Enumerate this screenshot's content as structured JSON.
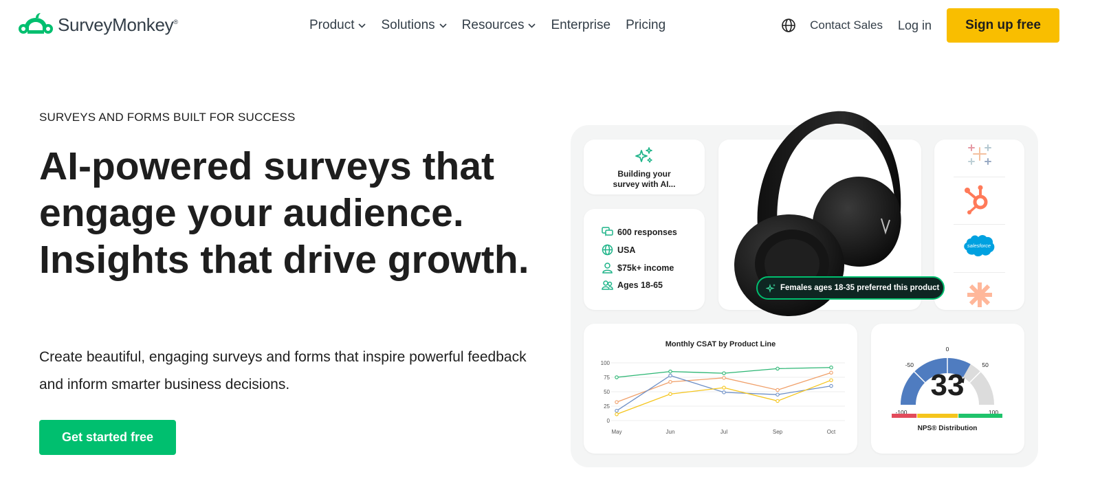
{
  "brand": {
    "name": "SurveyMonkey",
    "mark": "®"
  },
  "nav": {
    "items": [
      {
        "label": "Product",
        "dropdown": true
      },
      {
        "label": "Solutions",
        "dropdown": true
      },
      {
        "label": "Resources",
        "dropdown": true
      },
      {
        "label": "Enterprise",
        "dropdown": false
      },
      {
        "label": "Pricing",
        "dropdown": false
      }
    ],
    "contact_label": "Contact Sales",
    "login_label": "Log in",
    "signup_label": "Sign up free"
  },
  "hero": {
    "eyebrow": "SURVEYS AND FORMS BUILT FOR SUCCESS",
    "headline": "AI-powered surveys that engage your audience. Insights that drive growth.",
    "subtext": "Create beautiful, engaging surveys and forms that inspire powerful feedback and inform smarter business decisions.",
    "cta_label": "Get started free"
  },
  "visual": {
    "ai_card": {
      "text_line1": "Building your",
      "text_line2": "survey with AI..."
    },
    "audience": [
      {
        "icon": "chat-bubbles-icon",
        "label": "600 responses"
      },
      {
        "icon": "globe-icon",
        "label": "USA"
      },
      {
        "icon": "person-icon",
        "label": "$75k+ income"
      },
      {
        "icon": "people-icon",
        "label": "Ages 18-65"
      }
    ],
    "insight_pill": "Females ages 18-35 preferred this product",
    "integrations": [
      "tableau-logo",
      "hubspot-logo",
      "salesforce-logo",
      "zapier-logo"
    ],
    "integration_label": "salesforce"
  },
  "colors": {
    "brand_green": "#00bf6f",
    "signup_yellow": "#f9be00",
    "text": "#1e1e1e"
  },
  "chart_data": {
    "type": "line",
    "title": "Monthly CSAT by Product Line",
    "categories": [
      "May",
      "Jun",
      "Jul",
      "Sep",
      "Oct"
    ],
    "y_ticks": [
      0,
      25,
      50,
      75,
      100
    ],
    "ylim": [
      0,
      100
    ],
    "grid": true,
    "legend": "none",
    "series": [
      {
        "color": "#2bb673",
        "values": [
          75,
          85,
          82,
          90,
          92
        ]
      },
      {
        "color": "#f0a06a",
        "values": [
          32,
          67,
          74,
          53,
          83
        ]
      },
      {
        "color": "#6d8fc6",
        "values": [
          17,
          78,
          49,
          45,
          60
        ]
      },
      {
        "color": "#f5c51c",
        "values": [
          11,
          46,
          57,
          34,
          70
        ]
      }
    ]
  },
  "nps": {
    "value": "33",
    "label": "NPS® Distribution",
    "ticks": [
      "-100",
      "-50",
      "0",
      "50",
      "100"
    ],
    "score": 33,
    "range": [
      -100,
      100
    ],
    "segment_colors": [
      "#e24b5b",
      "#f5c51c",
      "#1fc36b"
    ]
  }
}
